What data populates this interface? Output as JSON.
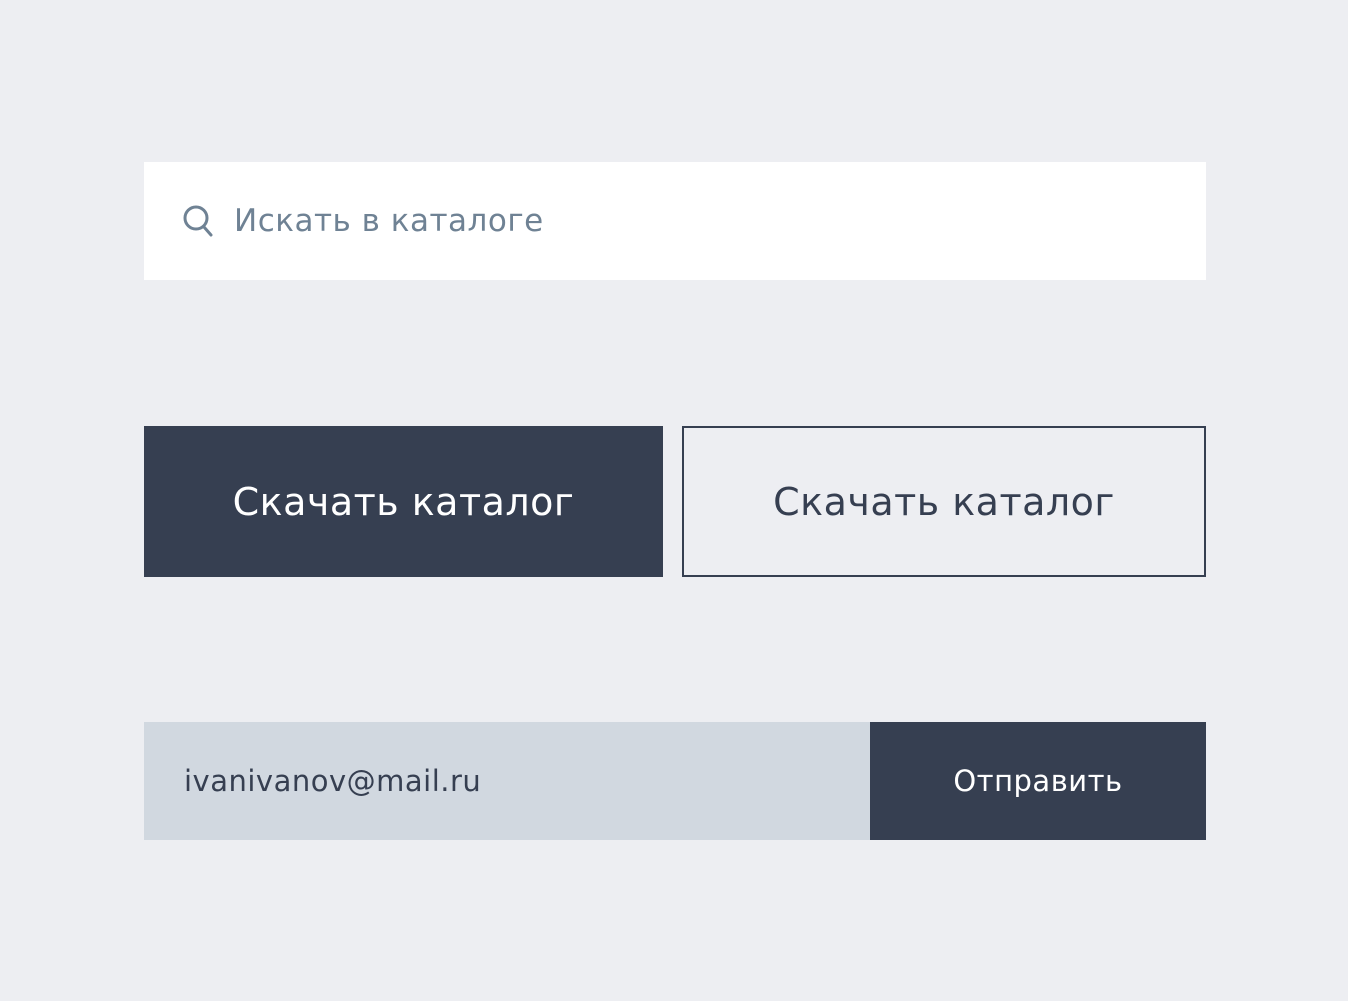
{
  "search": {
    "placeholder": "Искать в каталоге",
    "value": "",
    "icon": "search-icon"
  },
  "buttons": {
    "download_filled_label": "Скачать каталог",
    "download_outline_label": "Скачать каталог"
  },
  "subscribe": {
    "email_value": "ivanivanov@mail.ru",
    "submit_label": "Отправить"
  },
  "colors": {
    "background": "#edeef2",
    "primary": "#363f51",
    "input_fill": "#d1d8e0",
    "placeholder": "#6f8294"
  }
}
